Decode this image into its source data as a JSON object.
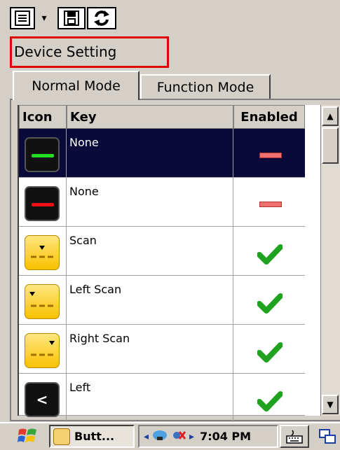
{
  "window": {
    "title": "Device Setting"
  },
  "tabs": [
    {
      "label": "Normal Mode",
      "active": true
    },
    {
      "label": "Function Mode",
      "active": false
    }
  ],
  "table": {
    "columns": [
      "Icon",
      "Key",
      "Enabled"
    ],
    "rows": [
      {
        "icon": "black-green-bar-icon",
        "key": "None",
        "enabled": false,
        "selected": true
      },
      {
        "icon": "black-red-bar-icon",
        "key": "None",
        "enabled": false,
        "selected": false
      },
      {
        "icon": "yellow-scan-icon",
        "key": "Scan",
        "enabled": true,
        "selected": false
      },
      {
        "icon": "yellow-left-scan-icon",
        "key": "Left Scan",
        "enabled": true,
        "selected": false
      },
      {
        "icon": "yellow-right-scan-icon",
        "key": "Right Scan",
        "enabled": true,
        "selected": false
      },
      {
        "icon": "black-left-arrow-icon",
        "key": "Left",
        "enabled": true,
        "selected": false
      }
    ]
  },
  "taskbar": {
    "task_label": "Butt...",
    "clock": "7:04 PM"
  },
  "icons": {
    "left_arrow_glyph": "<"
  },
  "colors": {
    "selection": "#0a0a3a",
    "title_highlight": "#e00000",
    "check": "#1fa31f"
  }
}
